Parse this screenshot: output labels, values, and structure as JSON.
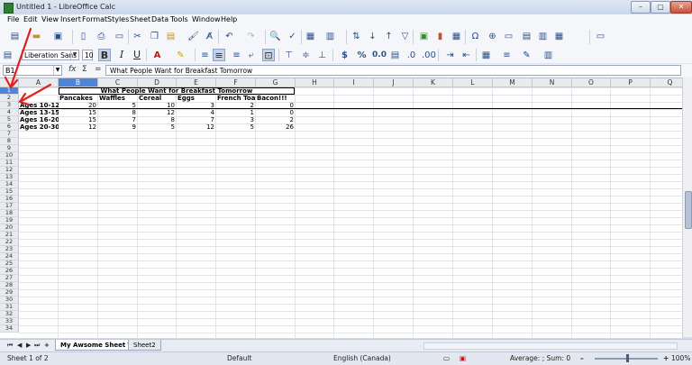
{
  "window": {
    "title": "Untitled 1 - LibreOffice Calc"
  },
  "menubar": [
    "File",
    "Edit",
    "View",
    "Insert",
    "Format",
    "Styles",
    "Sheet",
    "Data",
    "Tools",
    "Window",
    "Help"
  ],
  "toolbar": {
    "font_name": "Liberation Sans",
    "font_size": "10",
    "bold": "B",
    "italic": "I",
    "underline": "U",
    "currency": "$",
    "percent": "%",
    "number_format": "0.0"
  },
  "formula_bar": {
    "name_box": "B1",
    "fx": "fx",
    "sum": "Σ",
    "equals": "=",
    "content": "What People Want for Breakfast Tomorrow"
  },
  "columns": [
    "A",
    "B",
    "C",
    "D",
    "E",
    "F",
    "G",
    "H",
    "I",
    "J",
    "K",
    "L",
    "M",
    "N",
    "O",
    "P",
    "Q"
  ],
  "rows": [
    "1",
    "2",
    "3",
    "4",
    "5",
    "6",
    "7",
    "8",
    "9",
    "10",
    "11",
    "12",
    "13",
    "14",
    "15",
    "16",
    "17",
    "18",
    "19",
    "20",
    "21",
    "22",
    "23",
    "24",
    "25",
    "26",
    "27",
    "28",
    "29",
    "30",
    "31",
    "32",
    "33",
    "34"
  ],
  "sheet": {
    "title": "What People Want for Breakfast Tomorrow",
    "headers": [
      "Pancakes",
      "Waffles",
      "Cereal",
      "Eggs",
      "French Toast",
      "Bacon!!!"
    ],
    "data": [
      {
        "label": "Ages 10-12",
        "values": [
          "20",
          "5",
          "10",
          "3",
          "2",
          "0"
        ]
      },
      {
        "label": "Ages 13-15",
        "values": [
          "15",
          "8",
          "12",
          "4",
          "1",
          "0"
        ]
      },
      {
        "label": "Ages 16-20",
        "values": [
          "15",
          "7",
          "8",
          "7",
          "3",
          "2"
        ]
      },
      {
        "label": "Ages 20-30",
        "values": [
          "12",
          "9",
          "5",
          "12",
          "5",
          "26"
        ]
      }
    ]
  },
  "tabs": {
    "nav": [
      "⏮",
      "◀",
      "▶",
      "⏭",
      "+"
    ],
    "sheets": [
      "My Awsome Sheet Title",
      "Sheet2"
    ]
  },
  "status": {
    "sheet": "Sheet 1 of 2",
    "style": "Default",
    "language": "English (Canada)",
    "summary": "Average: ; Sum: 0",
    "zoom": "100%"
  },
  "colors": {
    "selection": "#4f84d9",
    "annotation": "#e02020"
  }
}
